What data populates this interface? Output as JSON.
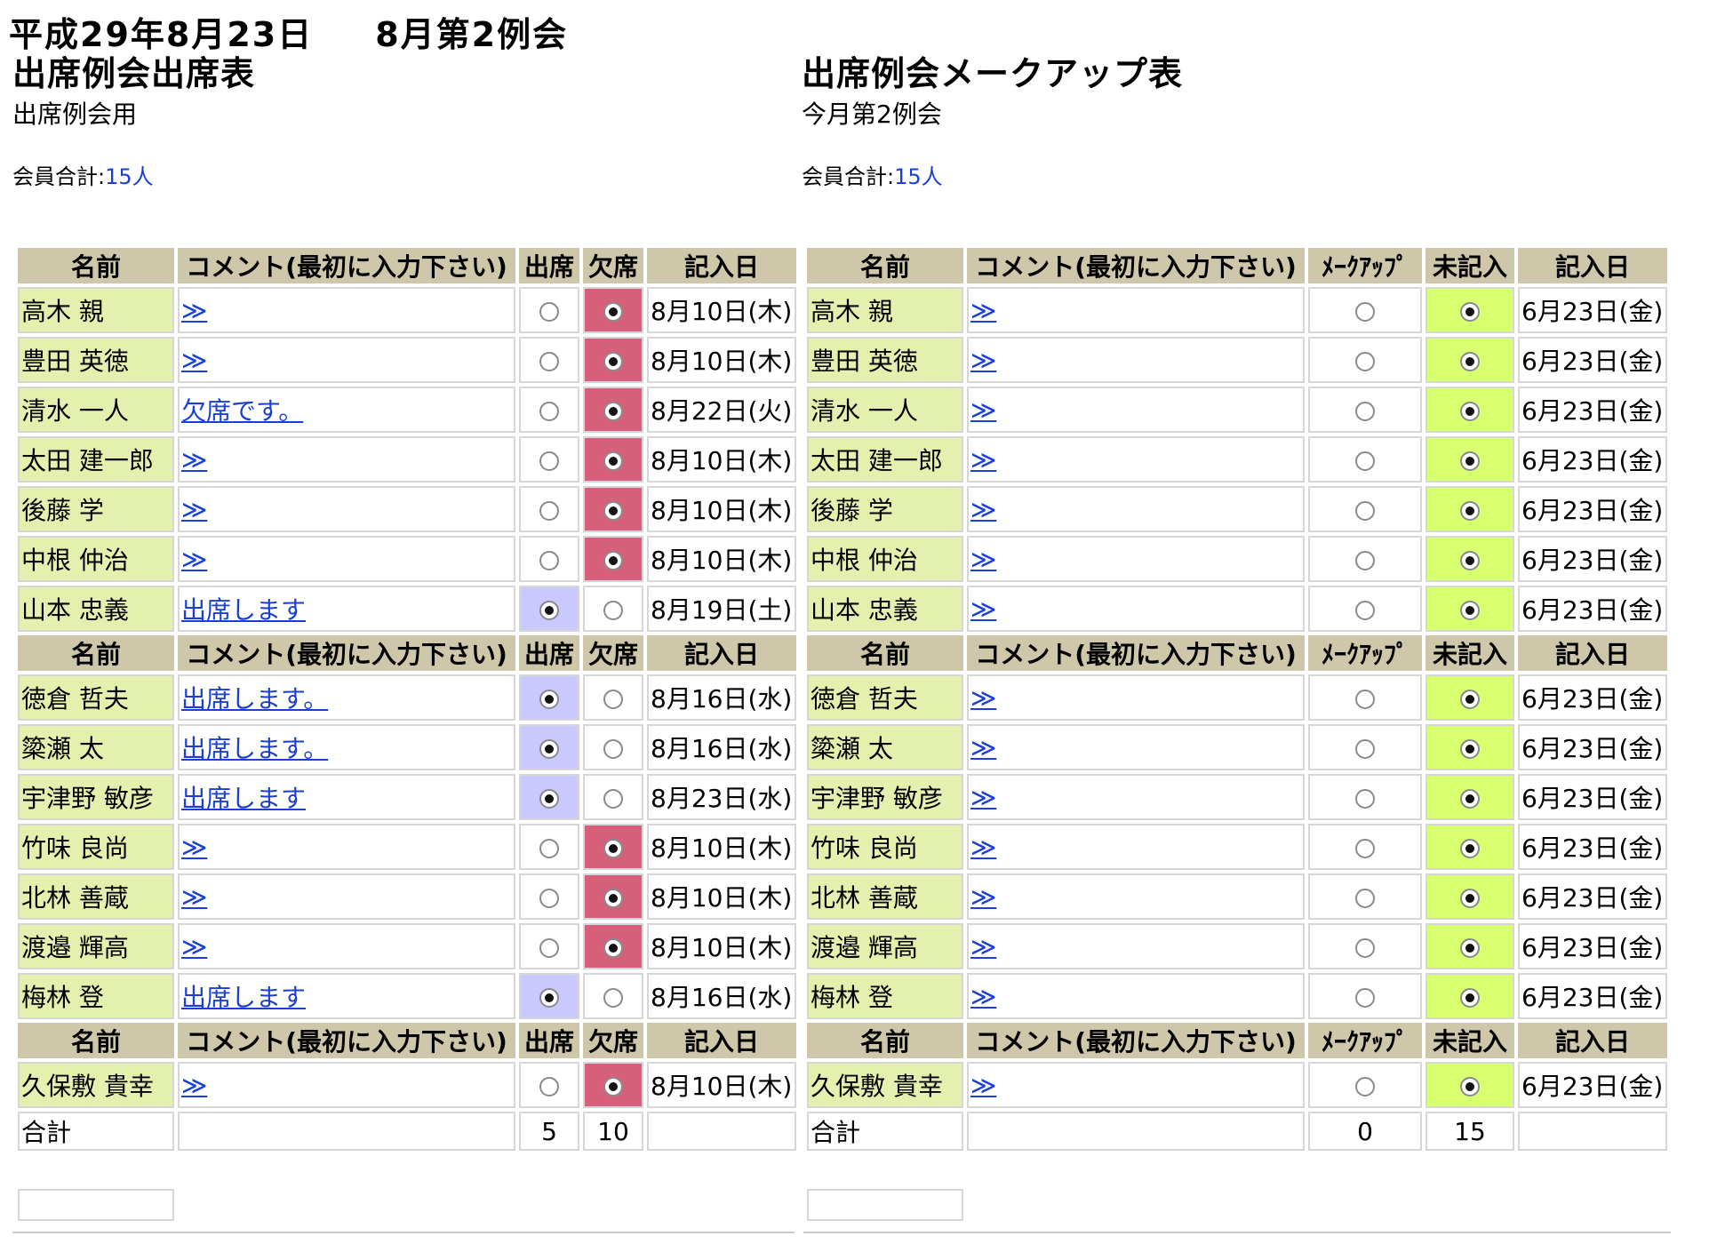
{
  "header": {
    "date": "平成29年8月23日",
    "meeting": "8月第2例会"
  },
  "left": {
    "title": "出席例会出席表",
    "subtitle": "出席例会用",
    "count_label": "会員合計:",
    "count_value": "15人",
    "columns": [
      "名前",
      "コメント(最初に入力下さい)",
      "出席",
      "欠席",
      "記入日"
    ],
    "rows": [
      {
        "name": "高木 親",
        "comment": "≫",
        "state": "absent",
        "date": "8月10日(木)"
      },
      {
        "name": "豊田 英徳",
        "comment": "≫",
        "state": "absent",
        "date": "8月10日(木)"
      },
      {
        "name": "清水 一人",
        "comment": "欠席です。",
        "state": "absent",
        "date": "8月22日(火)"
      },
      {
        "name": "太田 建一郎",
        "comment": "≫",
        "state": "absent",
        "date": "8月10日(木)"
      },
      {
        "name": "後藤 学",
        "comment": "≫",
        "state": "absent",
        "date": "8月10日(木)"
      },
      {
        "name": "中根 仲治",
        "comment": "≫",
        "state": "absent",
        "date": "8月10日(木)"
      },
      {
        "name": "山本 忠義",
        "comment": "出席します",
        "state": "present",
        "date": "8月19日(土)"
      },
      {
        "header": true
      },
      {
        "name": "徳倉 哲夫",
        "comment": "出席します。",
        "state": "present",
        "date": "8月16日(水)"
      },
      {
        "name": "簗瀬 太",
        "comment": "出席します。",
        "state": "present",
        "date": "8月16日(水)"
      },
      {
        "name": "宇津野 敏彦",
        "comment": "出席します",
        "state": "present",
        "date": "8月23日(水)"
      },
      {
        "name": "竹味 良尚",
        "comment": "≫",
        "state": "absent",
        "date": "8月10日(木)"
      },
      {
        "name": "北林 善蔵",
        "comment": "≫",
        "state": "absent",
        "date": "8月10日(木)"
      },
      {
        "name": "渡邉 輝高",
        "comment": "≫",
        "state": "absent",
        "date": "8月10日(木)"
      },
      {
        "name": "梅林 登",
        "comment": "出席します",
        "state": "present",
        "date": "8月16日(水)"
      },
      {
        "header": true
      },
      {
        "name": "久保敷 貴幸",
        "comment": "≫",
        "state": "absent",
        "date": "8月10日(木)"
      }
    ],
    "total": {
      "label": "合計",
      "col1": "5",
      "col2": "10"
    }
  },
  "right": {
    "title": "出席例会メークアップ表",
    "subtitle": "今月第2例会",
    "count_label": "会員合計:",
    "count_value": "15人",
    "columns": [
      "名前",
      "コメント(最初に入力下さい)",
      "ﾒｰｸｱｯﾌﾟ",
      "未記入",
      "記入日"
    ],
    "rows": [
      {
        "name": "高木 親",
        "comment": "≫",
        "state": "blank",
        "date": "6月23日(金)"
      },
      {
        "name": "豊田 英徳",
        "comment": "≫",
        "state": "blank",
        "date": "6月23日(金)"
      },
      {
        "name": "清水 一人",
        "comment": "≫",
        "state": "blank",
        "date": "6月23日(金)"
      },
      {
        "name": "太田 建一郎",
        "comment": "≫",
        "state": "blank",
        "date": "6月23日(金)"
      },
      {
        "name": "後藤 学",
        "comment": "≫",
        "state": "blank",
        "date": "6月23日(金)"
      },
      {
        "name": "中根 仲治",
        "comment": "≫",
        "state": "blank",
        "date": "6月23日(金)"
      },
      {
        "name": "山本 忠義",
        "comment": "≫",
        "state": "blank",
        "date": "6月23日(金)"
      },
      {
        "header": true
      },
      {
        "name": "徳倉 哲夫",
        "comment": "≫",
        "state": "blank",
        "date": "6月23日(金)"
      },
      {
        "name": "簗瀬 太",
        "comment": "≫",
        "state": "blank",
        "date": "6月23日(金)"
      },
      {
        "name": "宇津野 敏彦",
        "comment": "≫",
        "state": "blank",
        "date": "6月23日(金)"
      },
      {
        "name": "竹味 良尚",
        "comment": "≫",
        "state": "blank",
        "date": "6月23日(金)"
      },
      {
        "name": "北林 善蔵",
        "comment": "≫",
        "state": "blank",
        "date": "6月23日(金)"
      },
      {
        "name": "渡邉 輝高",
        "comment": "≫",
        "state": "blank",
        "date": "6月23日(金)"
      },
      {
        "name": "梅林 登",
        "comment": "≫",
        "state": "blank",
        "date": "6月23日(金)"
      },
      {
        "header": true
      },
      {
        "name": "久保敷 貴幸",
        "comment": "≫",
        "state": "blank",
        "date": "6月23日(金)"
      }
    ],
    "total": {
      "label": "合計",
      "col1": "0",
      "col2": "15"
    }
  },
  "colors": {
    "header_bg": "#cfc7a9",
    "name_bg": "#e4f0ae",
    "present_bg": "#c9c9ff",
    "absent_bg": "#d6607a",
    "blank_bg": "#d8ff70",
    "link": "#1a3fd6"
  }
}
